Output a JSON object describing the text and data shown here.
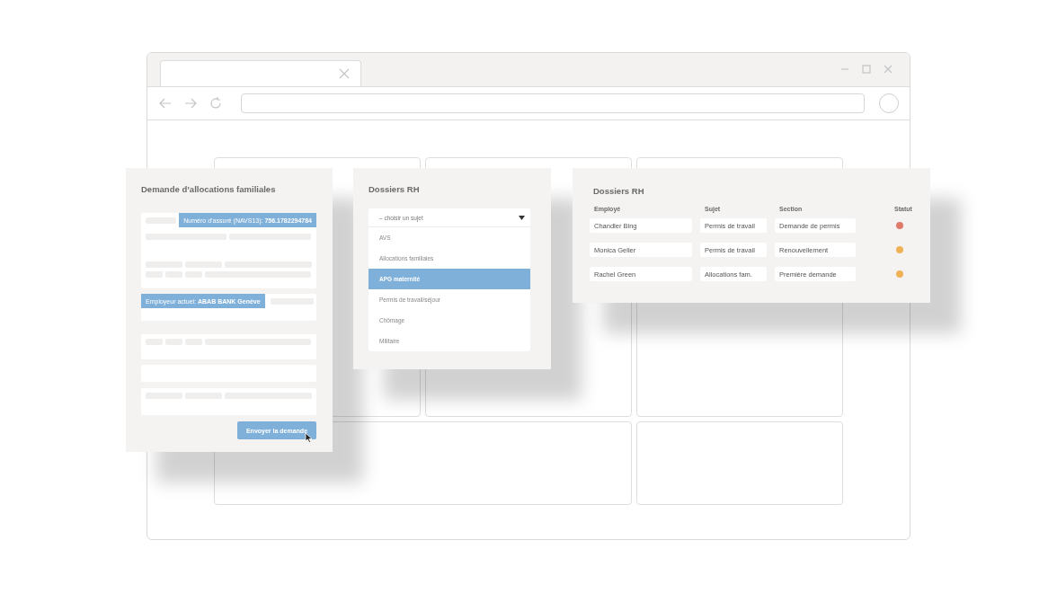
{
  "form_card": {
    "title": "Demande d’allocations familiales",
    "insured_number": "Numéro d’assuré (NAVS13): **756.1782294784**",
    "employer": "Employeur actuel: **ABAB BANK Genève**",
    "submit_button": "Envoyer la demande"
  },
  "dropdown_card": {
    "title": "Dossiers RH",
    "placeholder": "– choisir un sujet",
    "options": [
      {
        "label": "AVS",
        "selected": false
      },
      {
        "label": "Allocations familiales",
        "selected": false
      },
      {
        "label": "APG maternité",
        "selected": true
      },
      {
        "label": "Permis de travail/séjour",
        "selected": false
      },
      {
        "label": "Chômage",
        "selected": false
      },
      {
        "label": "Militaire",
        "selected": false
      }
    ]
  },
  "table_card": {
    "title": "Dossiers RH",
    "columns": [
      "Employé",
      "Sujet",
      "Section",
      "Statut"
    ],
    "rows": [
      {
        "employee": "Chandler Bing",
        "subject": "Permis de travail",
        "section": "Demande de permis",
        "color": "#e07a6a"
      },
      {
        "employee": "Monica Geller",
        "subject": "Permis de travail",
        "section": "Renouvellement",
        "color": "#efb259"
      },
      {
        "employee": "Rachel Green",
        "subject": "Allocations fam.",
        "section": "Première demande",
        "color": "#efb259"
      }
    ]
  }
}
